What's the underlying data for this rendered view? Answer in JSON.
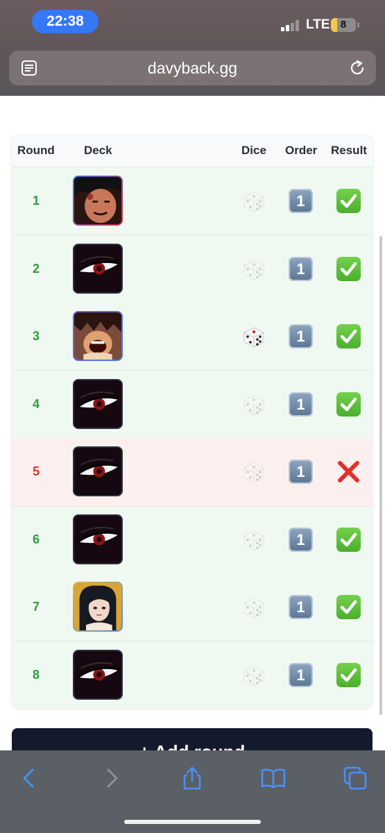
{
  "status_bar": {
    "time": "22:38",
    "network": "LTE",
    "battery": "8"
  },
  "browser": {
    "url": "davyback.gg",
    "reader_icon": "reader-mode-icon",
    "reload_icon": "reload-icon"
  },
  "table": {
    "headers": {
      "round": "Round",
      "deck": "Deck",
      "dice": "Dice",
      "order": "Order",
      "result": "Result"
    },
    "rows": [
      {
        "round": "1",
        "deck": "red-leader",
        "dice": "lost",
        "order": "1",
        "result": "win"
      },
      {
        "round": "2",
        "deck": "black-eye",
        "dice": "lost",
        "order": "1",
        "result": "win"
      },
      {
        "round": "3",
        "deck": "purple-leader",
        "dice": "won",
        "order": "1",
        "result": "win"
      },
      {
        "round": "4",
        "deck": "black-eye",
        "dice": "lost",
        "order": "1",
        "result": "win"
      },
      {
        "round": "5",
        "deck": "black-eye",
        "dice": "lost",
        "order": "1",
        "result": "loss"
      },
      {
        "round": "6",
        "deck": "black-eye",
        "dice": "lost",
        "order": "1",
        "result": "win"
      },
      {
        "round": "7",
        "deck": "yellow-leader",
        "dice": "lost",
        "order": "1",
        "result": "win"
      },
      {
        "round": "8",
        "deck": "black-eye",
        "dice": "lost",
        "order": "1",
        "result": "win"
      }
    ]
  },
  "add_round_label": "+ Add round",
  "colors": {
    "win_row": "#f0f9f1",
    "loss_row": "#fcf0ef",
    "win_text": "#2e9b3c",
    "loss_text": "#d8352e",
    "accent": "#3478f6",
    "button_dark": "#141a2b"
  },
  "toolbar": {
    "back": "chevron-left-icon",
    "forward": "chevron-right-icon",
    "share": "share-icon",
    "bookmarks": "book-icon",
    "tabs": "tabs-icon"
  }
}
